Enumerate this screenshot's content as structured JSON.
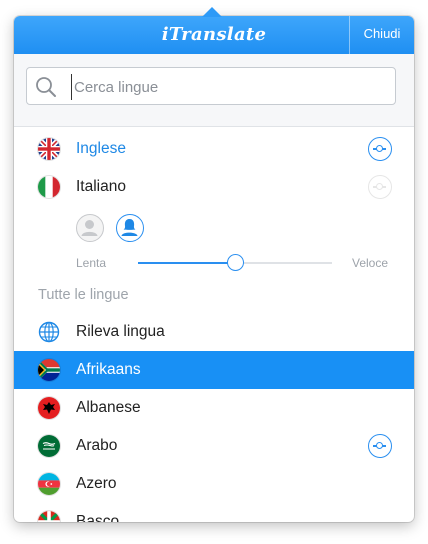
{
  "header": {
    "title": "iTranslate",
    "close_label": "Chiudi"
  },
  "search": {
    "placeholder": "Cerca lingue",
    "value": ""
  },
  "recent_languages": [
    {
      "label": "Inglese",
      "flag": "uk-flag",
      "active": true,
      "voice_toggle": "on"
    },
    {
      "label": "Italiano",
      "flag": "italy-flag",
      "active": false,
      "voice_toggle": "off"
    }
  ],
  "voice": {
    "selected": "female",
    "options": [
      "male",
      "female"
    ]
  },
  "speed": {
    "slow_label": "Lenta",
    "fast_label": "Veloce",
    "value": 0.5
  },
  "all_languages": {
    "title": "Tutte le lingue",
    "items": [
      {
        "label": "Rileva lingua",
        "icon": "globe-icon",
        "selected": false
      },
      {
        "label": "Afrikaans",
        "icon": "south-africa-flag",
        "selected": true
      },
      {
        "label": "Albanese",
        "icon": "albania-flag",
        "selected": false
      },
      {
        "label": "Arabo",
        "icon": "saudi-arabia-flag",
        "selected": false,
        "voice_toggle": "on"
      },
      {
        "label": "Azero",
        "icon": "azerbaijan-flag",
        "selected": false
      },
      {
        "label": "Basco",
        "icon": "basque-flag",
        "selected": false
      }
    ]
  },
  "colors": {
    "accent": "#1890f5",
    "header_top": "#3ea6fb",
    "header_bottom": "#1f8ff2"
  }
}
